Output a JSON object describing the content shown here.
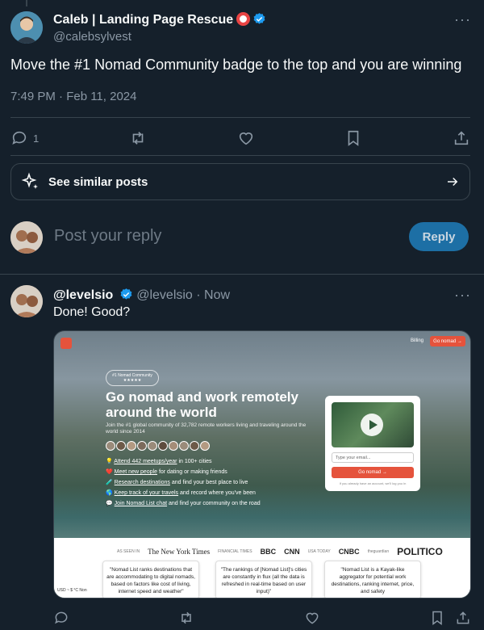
{
  "post": {
    "author_name": "Caleb | Landing Page Rescue",
    "author_handle": "@calebsylvest",
    "text": "Move the #1 Nomad Community badge to the top and you are winning",
    "timestamp": "7:49 PM · Feb 11, 2024",
    "reply_count": "1",
    "more_label": "···"
  },
  "similar": {
    "label": "See similar posts"
  },
  "compose": {
    "placeholder": "Post your reply",
    "button_label": "Reply"
  },
  "reply": {
    "author_name": "@levelsio",
    "author_handle": "@levelsio",
    "time": "· Now",
    "text": "Done! Good?",
    "more_label": "···"
  },
  "media": {
    "billing": "Billing",
    "cta": "Go nomad →",
    "badge_title": "#1 Nomad Community",
    "badge_stars": "★★★★★",
    "headline": "Go nomad and work remotely around the world",
    "subtitle": "Join the #1 global community of 32,782 remote workers living and traveling around the world since 2014",
    "list": [
      {
        "pre": "💡 ",
        "link": "Attend 442 meetups/year",
        "post": " in 100+ cities"
      },
      {
        "pre": "❤️ ",
        "link": "Meet new people",
        "post": " for dating or making friends"
      },
      {
        "pre": "🧪 ",
        "link": "Research destinations",
        "post": " and find your best place to live"
      },
      {
        "pre": "🌎 ",
        "link": "Keep track of your travels",
        "post": " and record where you've been"
      },
      {
        "pre": "💬 ",
        "link": "Join Nomad List chat",
        "post": " and find your community on the road"
      }
    ],
    "email_placeholder": "Type your email...",
    "go_button": "Go nomad →",
    "fine_print": "If you already have an account, we'll log you in",
    "logos": [
      "AS SEEN IN",
      "The New York Times",
      "FINANCIAL TIMES",
      "BBC",
      "CNN",
      "USA TODAY",
      "CNBC",
      "theguardian",
      "POLITICO"
    ],
    "quotes": [
      "\"Nomad List ranks destinations that are accommodating to digital nomads, based on factors like cost of living, internet speed and weather\"",
      "\"The rankings of [Nomad List]'s cities are constantly in flux (all the data is refreshed in real-time based on user input)\"",
      "\"Nomad List is a Kayak-like aggregator for potential work destinations, ranking internet, price, and safety"
    ],
    "footer_bar": "USD ~ $  °C  Non"
  },
  "colors": {
    "background": "#15202b",
    "accent": "#1d9bf0",
    "reply_button": "#1d6fa5",
    "muted_text": "#8b98a5",
    "border": "#38444d",
    "nomad_red": "#e5533c"
  }
}
